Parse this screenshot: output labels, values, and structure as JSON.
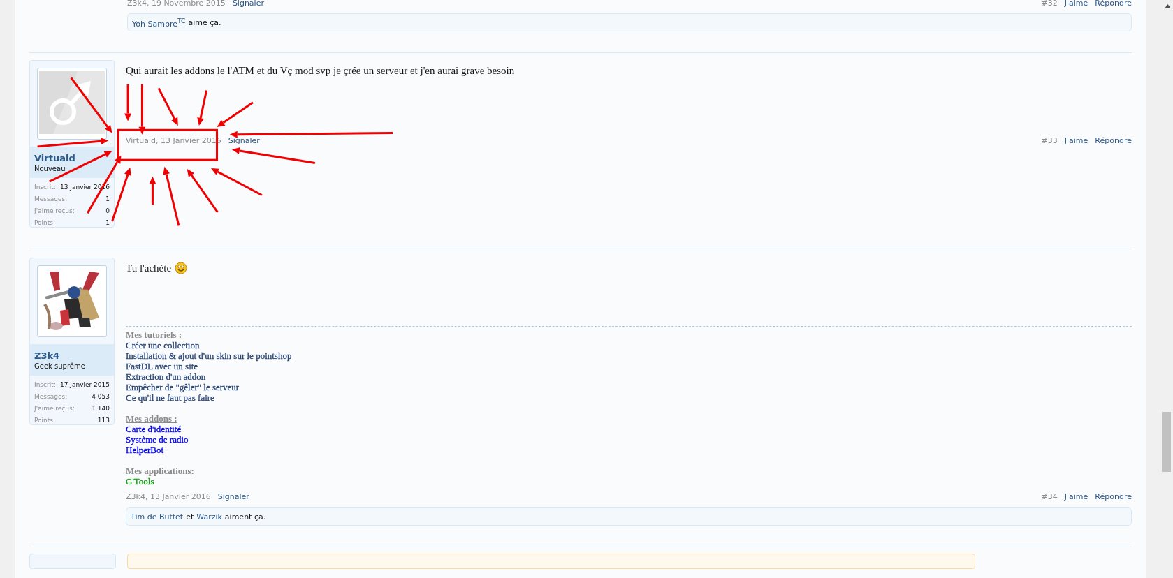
{
  "top_post": {
    "meta": "Z3k4, 19 Novembre 2015",
    "report": "Signaler",
    "number": "#32",
    "like": "J'aime",
    "reply": "Répondre",
    "likes": [
      {
        "kind": "user",
        "text": "Yoh Sambre$^{TC}$"
      },
      {
        "kind": "plain",
        "text": "aime ça."
      }
    ]
  },
  "posts": [
    {
      "user": {
        "name": "Virtuald",
        "rank": "Nouveau",
        "avatar": {
          "kind": "icon"
        },
        "stats": [
          {
            "label": "Inscrit:",
            "value": "13 Janvier 2016"
          },
          {
            "label": "Messages:",
            "value": "1"
          },
          {
            "label": "J'aime reçus:",
            "value": "0"
          },
          {
            "label": "Points:",
            "value": "1"
          }
        ]
      },
      "message": "Qui aurait les addons le l'ATM et du Vç mod svp je çrée un serveur et j'en aurai grave besoin",
      "smiley": false,
      "meta": "Virtuald, 13 Janvier 2016",
      "report": "Signaler",
      "number": "#33",
      "like": "J'aime",
      "reply": "Répondre",
      "annotated": true
    },
    {
      "user": {
        "name": "Z3k4",
        "rank": "Geek suprême",
        "stats": [
          {
            "label": "Inscrit:",
            "value": "17 Janvier 2015"
          },
          {
            "label": "Messages:",
            "value": "4 053"
          },
          {
            "label": "J'aime reçus:",
            "value": "1 140"
          },
          {
            "label": "Points:",
            "value": "113"
          }
        ]
      },
      "message": "Tu l'achète",
      "smiley": true,
      "signature": [
        {
          "heading": "Mes tutoriels :",
          "color": "#2a4675",
          "items": [
            "Créer une collection",
            "Installation & ajout d'un skin sur le pointshop",
            "FastDL avec un site",
            "Extraction d'un addon",
            "Empêcher de \"gêler\" le serveur",
            "Ce qu'il ne faut pas faire"
          ]
        },
        {
          "heading": "Mes addons :",
          "color": "#0000ff",
          "items": [
            "Carte d'identité",
            "Système de radio",
            "HelperBot"
          ]
        },
        {
          "heading": "Mes applications:",
          "color": "#14a014",
          "items": [
            "G'Tools"
          ]
        }
      ],
      "meta": "Z3k4, 13 Janvier 2016",
      "report": "Signaler",
      "number": "#34",
      "like": "J'aime",
      "reply": "Répondre",
      "annotated": false,
      "likes": [
        {
          "kind": "user",
          "text": "Tim de Buttet"
        },
        {
          "kind": "plain",
          "text": "et"
        },
        {
          "kind": "user",
          "text": "Warzik"
        },
        {
          "kind": "plain",
          "text": "aiment ça."
        }
      ]
    }
  ]
}
